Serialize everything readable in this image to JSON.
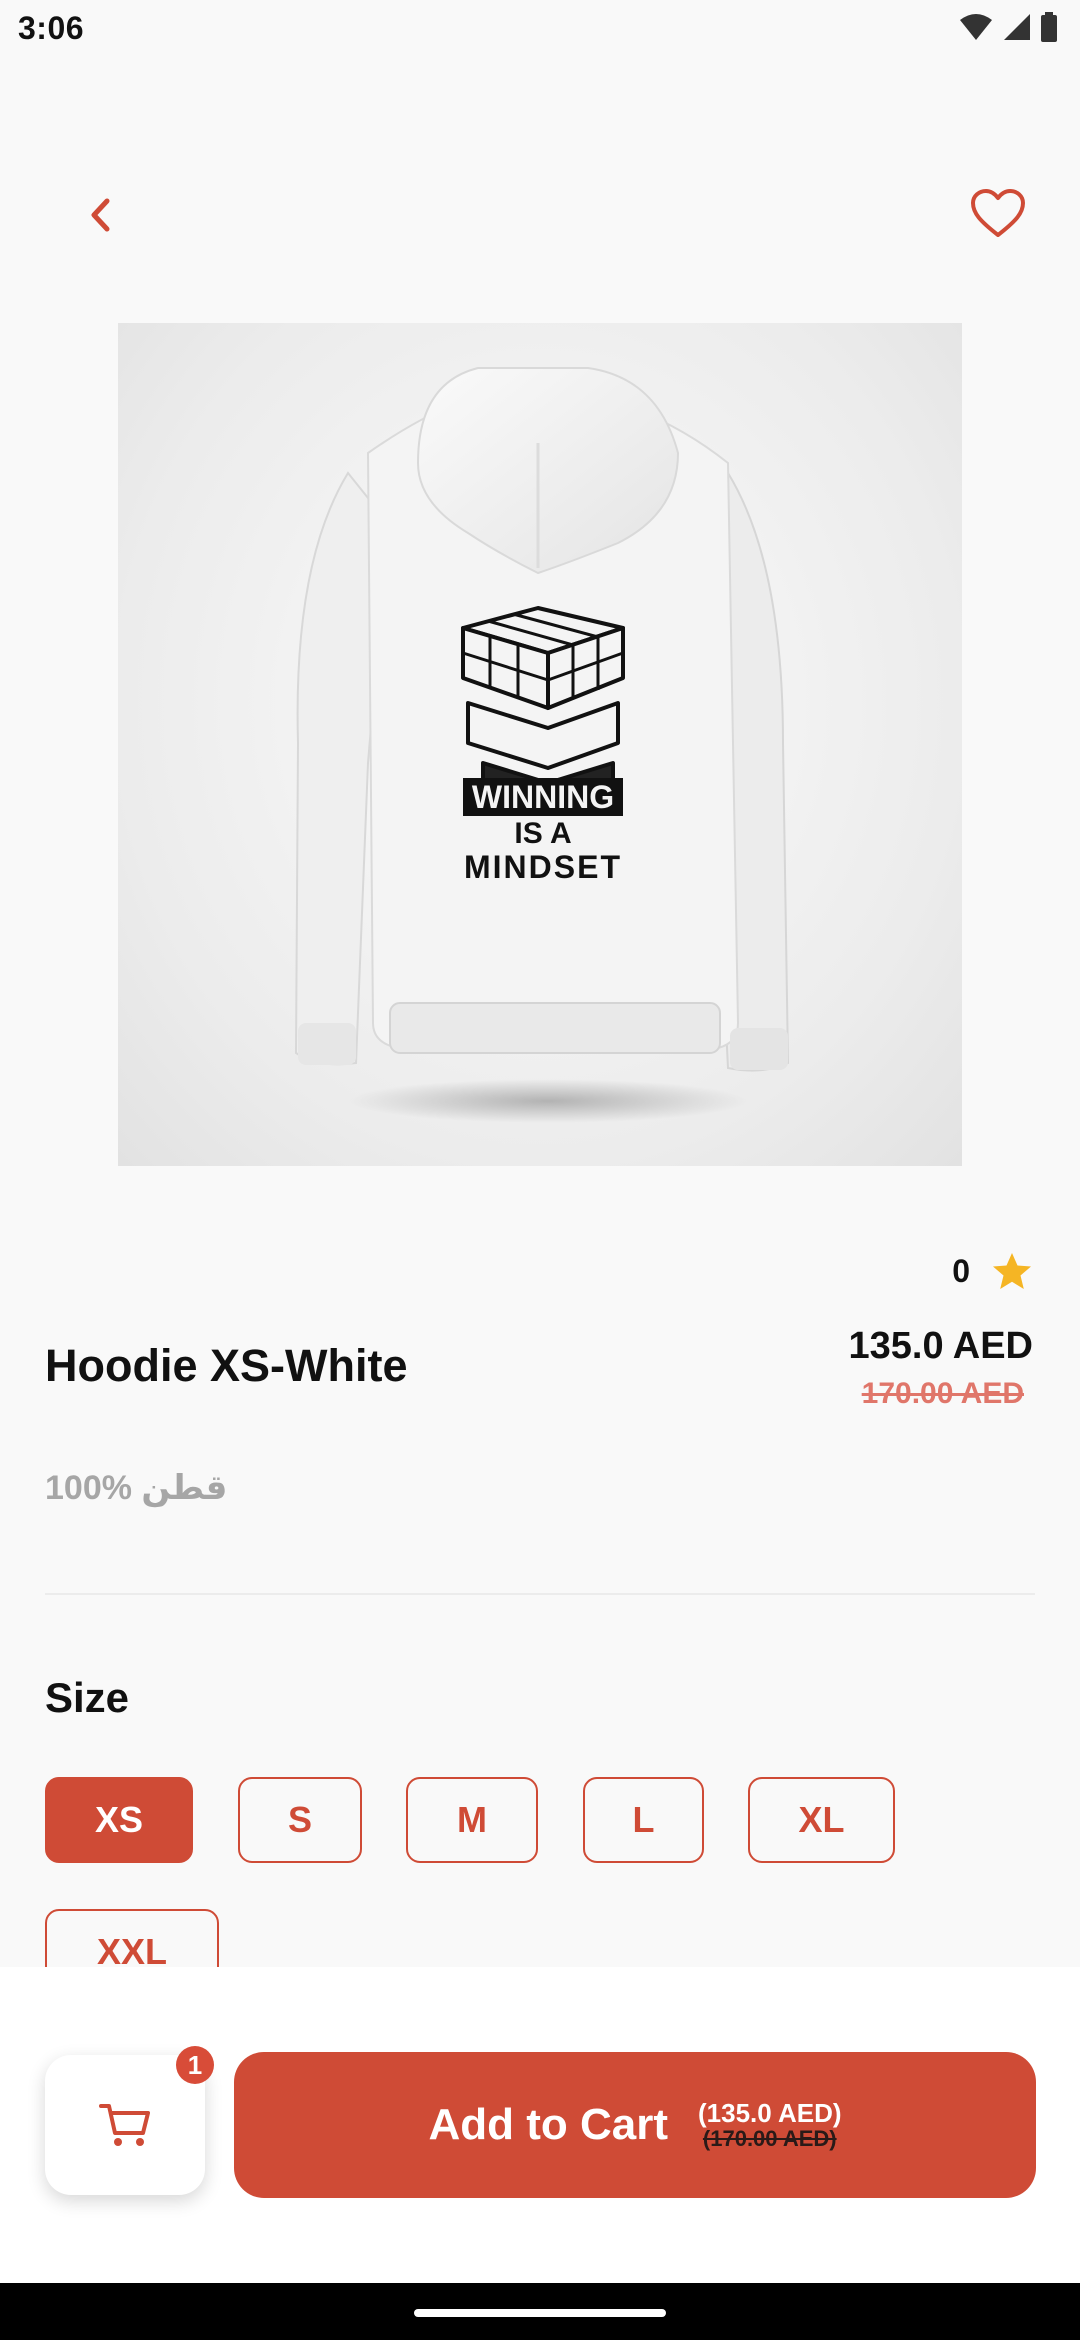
{
  "status_bar": {
    "time": "3:06"
  },
  "product": {
    "name": "Hoodie XS-White",
    "description": "100% قطن",
    "rating": "0",
    "price": "135.0 AED",
    "old_price": "170.00 AED",
    "print_text": {
      "line1": "WINNING",
      "line2": "IS A",
      "line3": "MINDSET"
    }
  },
  "size": {
    "heading": "Size",
    "options": [
      "XS",
      "S",
      "M",
      "L",
      "XL",
      "XXL"
    ],
    "selected": "XS"
  },
  "cart": {
    "badge_count": "1",
    "add_label": "Add to Cart",
    "add_price": "(135.0 AED)",
    "add_old_price": "(170.00 AED)"
  },
  "colors": {
    "accent": "#cf4b36",
    "old_price": "#e0766a",
    "star": "#f5b524",
    "muted_text": "#a6a6a6"
  },
  "icons": [
    "wifi-icon",
    "signal-icon",
    "battery-icon",
    "back-arrow-icon",
    "heart-icon",
    "star-icon",
    "cart-icon"
  ]
}
